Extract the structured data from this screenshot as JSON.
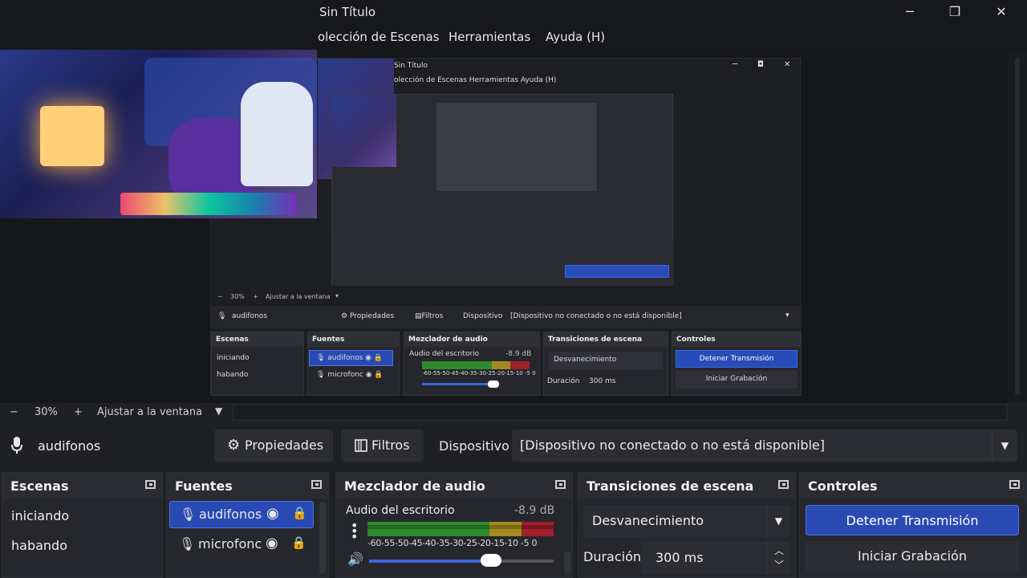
{
  "window": {
    "title": "Sin Título",
    "minimize_glyph": "─",
    "maximize_glyph": "❐",
    "close_glyph": "✕"
  },
  "menu": {
    "items": [
      "olección de Escenas",
      "Herramientas",
      "Ayuda (H)"
    ]
  },
  "nested_preview": {
    "title": "Sin Título",
    "menu": "olección de Escenas   Herramientas   Ayuda (H)",
    "zoom": "30%",
    "fit": "Ajustar a la ventana",
    "source": "audifonos",
    "properties": "Propiedades",
    "filters": "Filtros",
    "device_label": "Dispositivo",
    "device_value": "[Dispositivo no conectado o no está disponible]",
    "docks": {
      "scenes": "Escenas",
      "sources": "Fuentes",
      "mixer": "Mezclador de audio",
      "transitions": "Transiciones de escena",
      "controls": "Controles"
    },
    "scene_items": [
      "iniciando",
      "habando"
    ],
    "source_items": [
      "audifonos",
      "microfonc"
    ],
    "mixer_channel": "Audio del escritorio",
    "mixer_db": "-8.9 dB",
    "mixer_scale": "-60-55-50-45-40-35-30-25-20-15-10 -5 0",
    "transition": "Desvanecimiento",
    "duration_label": "Duración",
    "duration_value": "300 ms",
    "stop_stream": "Detener Transmisión",
    "start_record": "Iniciar Grabación"
  },
  "zoom_bar": {
    "minus": "−",
    "zoom": "30%",
    "plus": "+",
    "fit": "Ajustar a la ventana"
  },
  "source_toolbar": {
    "source_name": "audifonos",
    "properties": "Propiedades",
    "filters": "Filtros",
    "device_label": "Dispositivo",
    "device_value": "[Dispositivo no conectado o no está disponible]"
  },
  "docks": {
    "scenes": {
      "title": "Escenas",
      "items": [
        "iniciando",
        "habando"
      ]
    },
    "sources": {
      "title": "Fuentes",
      "items": [
        "audifonos",
        "microfonc"
      ]
    },
    "mixer": {
      "title": "Mezclador de audio",
      "channel": "Audio del escritorio",
      "db": "-8.9 dB",
      "scale": "-60-55-50-45-40-35-30-25-20-15-10 -5 0",
      "volume_fraction": 0.65
    },
    "transitions": {
      "title": "Transiciones de escena",
      "selected": "Desvanecimiento",
      "duration_label": "Duración",
      "duration_value": "300 ms"
    },
    "controls": {
      "title": "Controles",
      "stop_stream": "Detener Transmisión",
      "start_record": "Iniciar Grabación"
    }
  },
  "colors": {
    "accent_blue": "#2a4ab3",
    "meter_green": "#2e8b2e",
    "meter_yellow": "#a48a1e",
    "meter_red": "#a01f2b"
  }
}
